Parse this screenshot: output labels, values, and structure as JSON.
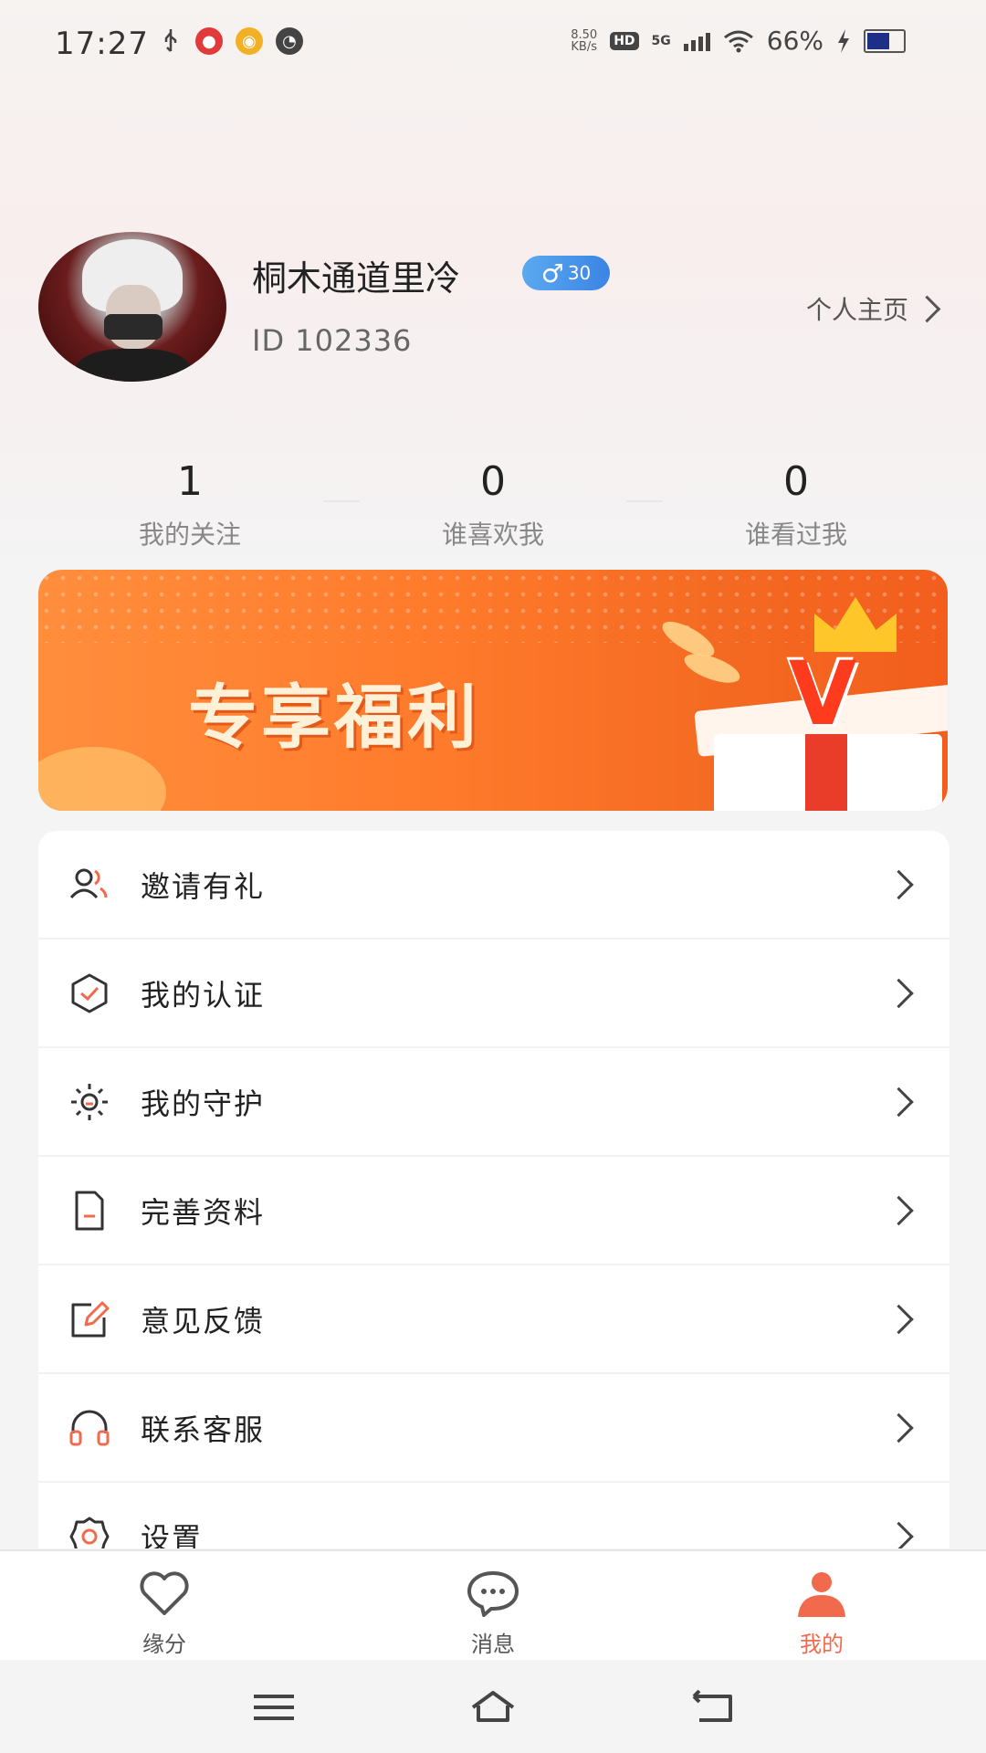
{
  "status_bar": {
    "time": "17:27",
    "net_speed_value": "8.50",
    "net_speed_unit": "KB/s",
    "hd_badge": "HD",
    "network": "5G",
    "battery_percent": "66%",
    "battery_level": 0.66
  },
  "profile": {
    "username": "桐木通道里冷",
    "gender_symbol": "♂",
    "level": "30",
    "id_text": "ID 102336",
    "homepage_link": "个人主页"
  },
  "stats": [
    {
      "value": "1",
      "label": "我的关注"
    },
    {
      "value": "0",
      "label": "谁喜欢我"
    },
    {
      "value": "0",
      "label": "谁看过我"
    }
  ],
  "banner": {
    "title": "专享福利",
    "logo_letter": "V"
  },
  "menu": {
    "items": [
      {
        "label": "邀请有礼",
        "icon": "invite-users-icon"
      },
      {
        "label": "我的认证",
        "icon": "verification-check-icon"
      },
      {
        "label": "我的守护",
        "icon": "guard-sun-icon"
      },
      {
        "label": "完善资料",
        "icon": "profile-document-icon"
      },
      {
        "label": "意见反馈",
        "icon": "feedback-edit-icon"
      },
      {
        "label": "联系客服",
        "icon": "headset-icon"
      },
      {
        "label": "设置",
        "icon": "settings-gear-icon"
      }
    ]
  },
  "bottom_nav": {
    "items": [
      {
        "label": "缘分",
        "icon": "heart-icon",
        "active": false
      },
      {
        "label": "消息",
        "icon": "chat-bubble-icon",
        "active": false
      },
      {
        "label": "我的",
        "icon": "person-icon",
        "active": true
      }
    ]
  },
  "colors": {
    "accent": "#f26a4d",
    "banner_orange": "#ff7a2b",
    "badge_blue": "#3b84e5"
  }
}
